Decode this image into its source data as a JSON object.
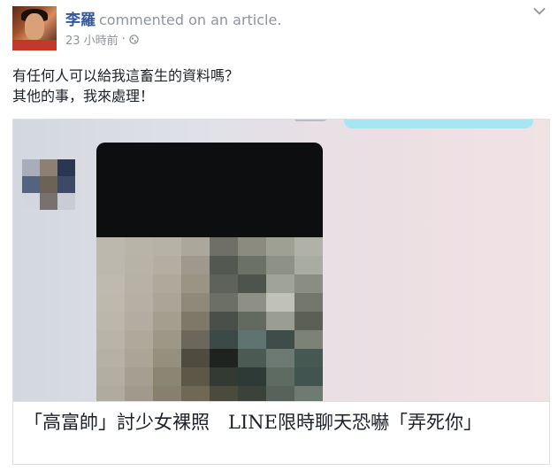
{
  "post": {
    "author": "李羅",
    "action": "commented on an article.",
    "time": "23 小時前",
    "separator": "·",
    "privacy_icon": "globe-icon",
    "options_icon": "chevron-down-icon"
  },
  "message": {
    "line1": "有任何人可以給我這畜生的資料嗎？",
    "line2": "其他的事，我來處理！"
  },
  "attachment": {
    "image_description_icon": "blurred-chat-screenshot",
    "title": "「高富帥」討少女裸照　LINE限時聊天恐嚇「弄死你」"
  },
  "colors": {
    "author": "#365899",
    "meta": "#90949c",
    "text": "#1d2129",
    "border": "#dddfe2"
  }
}
